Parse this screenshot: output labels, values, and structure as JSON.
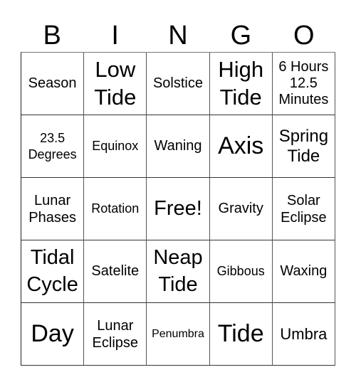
{
  "header": {
    "letters": [
      "B",
      "I",
      "N",
      "G",
      "O"
    ]
  },
  "cells": [
    [
      "Season",
      "Low Tide",
      "Solstice",
      "High Tide",
      "6 Hours 12.5 Minutes"
    ],
    [
      "23.5 Degrees",
      "Equinox",
      "Waning",
      "Axis",
      "Spring Tide"
    ],
    [
      "Lunar Phases",
      "Rotation",
      "Free!",
      "Gravity",
      "Solar Eclipse"
    ],
    [
      "Tidal Cycle",
      "Satelite",
      "Neap Tide",
      "Gibbous",
      "Waxing"
    ],
    [
      "Day",
      "Lunar Eclipse",
      "Penumbra",
      "Tide",
      "Umbra"
    ]
  ]
}
